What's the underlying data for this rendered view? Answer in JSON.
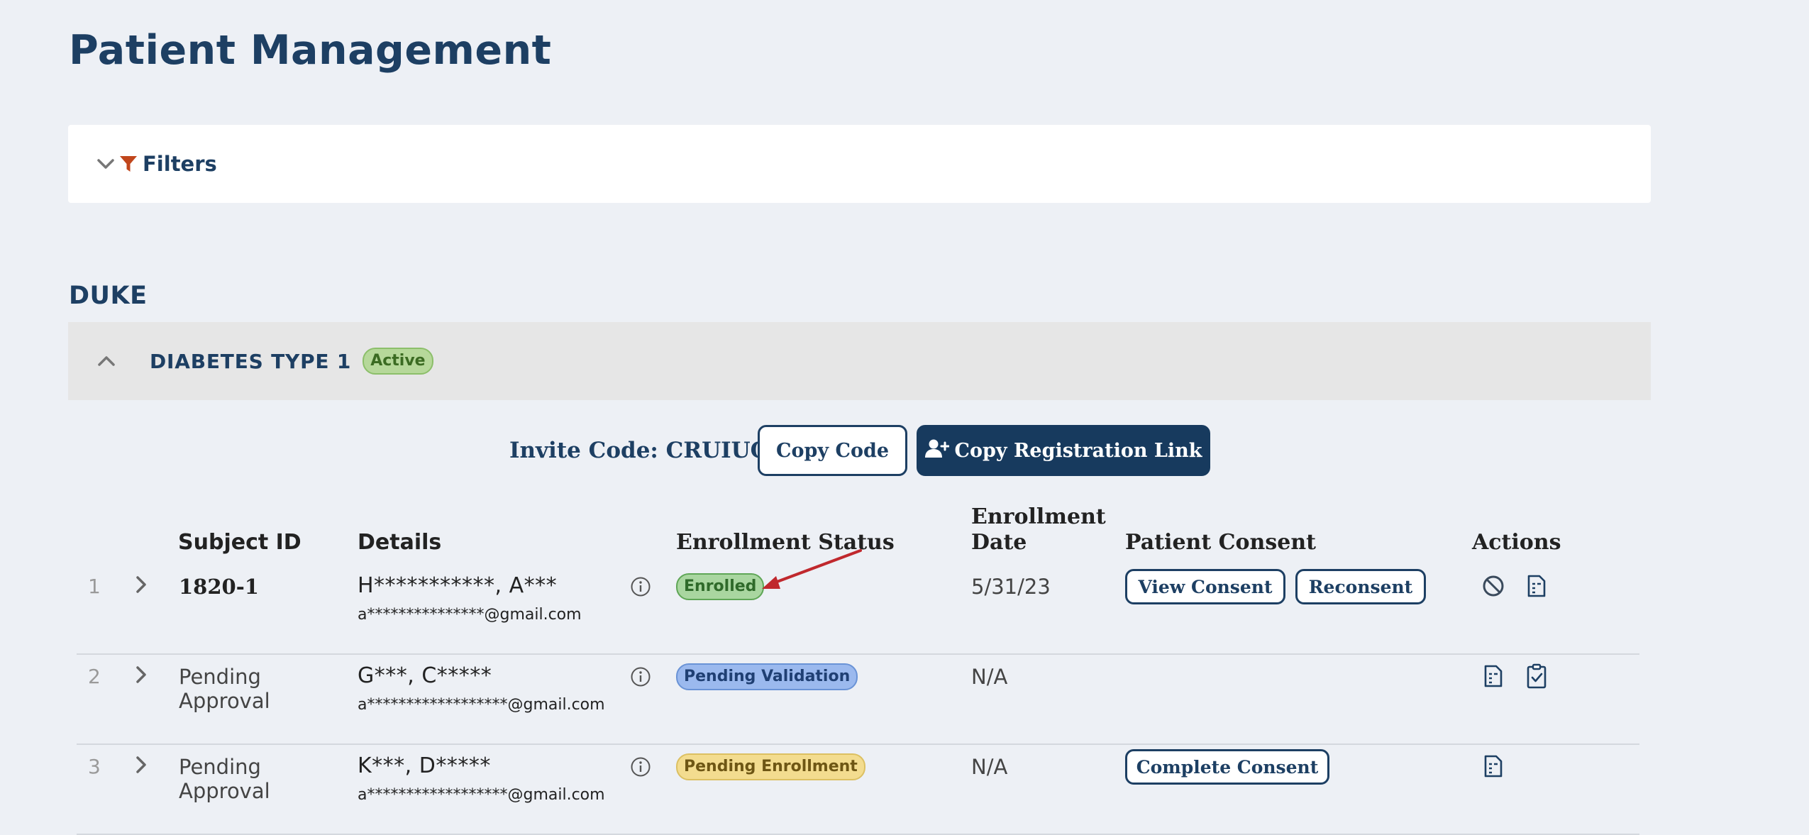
{
  "page": {
    "title": "Patient Management"
  },
  "filters": {
    "label": "Filters",
    "icons": [
      "chevron-down-icon",
      "funnel-icon"
    ]
  },
  "site": {
    "name": "DUKE"
  },
  "program": {
    "name": "DIABETES TYPE 1",
    "status": "Active"
  },
  "invite": {
    "label": "Invite Code: CRUIUO",
    "copy_code_label": "Copy Code",
    "copy_link_label": "Copy Registration Link"
  },
  "table": {
    "headers": {
      "subject_id": "Subject ID",
      "details": "Details",
      "enrollment_status": "Enrollment Status",
      "enrollment_date_line1": "Enrollment",
      "enrollment_date_line2": "Date",
      "patient_consent": "Patient Consent",
      "actions": "Actions"
    },
    "rows": [
      {
        "index": "1",
        "subject_id": "1820-1",
        "name": "H***********, A***",
        "email": "a***************@gmail.com",
        "status": "Enrolled",
        "date": "5/31/23",
        "consent_buttons": [
          "View Consent",
          "Reconsent"
        ],
        "actions": [
          "ban-icon",
          "document-icon"
        ]
      },
      {
        "index": "2",
        "subject_id_line1": "Pending",
        "subject_id_line2": "Approval",
        "name": "G***, C*****",
        "email": "a******************@gmail.com",
        "status": "Pending Validation",
        "date": "N/A",
        "consent_buttons": [],
        "actions": [
          "document-icon",
          "clipboard-check-icon"
        ]
      },
      {
        "index": "3",
        "subject_id_line1": "Pending",
        "subject_id_line2": "Approval",
        "name": "K***, D*****",
        "email": "a******************@gmail.com",
        "status": "Pending Enrollment",
        "date": "N/A",
        "consent_buttons": [
          "Complete Consent"
        ],
        "actions": [
          "document-icon"
        ]
      }
    ]
  },
  "colors": {
    "primary": "#1d3f63",
    "background": "#edf0f5",
    "enrolled": "#a9d6a0",
    "pending_validation": "#9bb9ee",
    "pending_enrollment": "#f3dc8f",
    "annotation_arrow": "#c0282d"
  }
}
